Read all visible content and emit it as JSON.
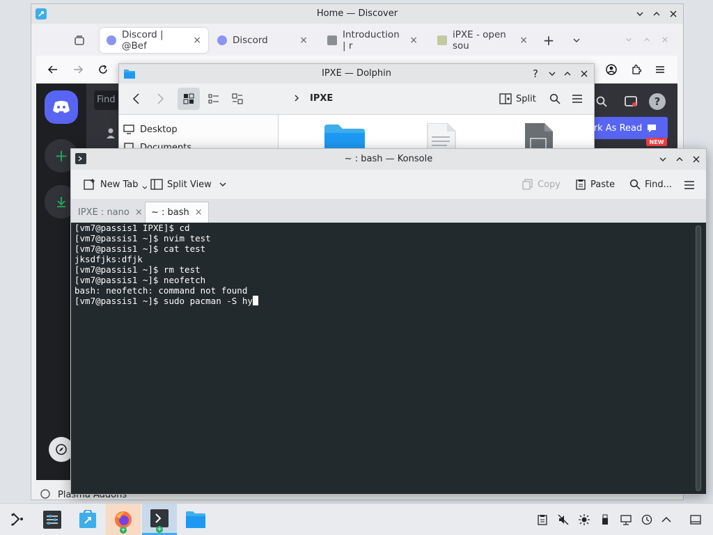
{
  "discover": {
    "title": "Home — Discover",
    "plasma_item": "Plasma Addons"
  },
  "firefox": {
    "tabs": [
      {
        "label": "Discord | @Bef",
        "close": "×"
      },
      {
        "label": "Discord",
        "close": "×"
      },
      {
        "label": "Introduction | r",
        "close": "×"
      },
      {
        "label": "iPXE - open sou",
        "close": "×"
      }
    ],
    "new_tab": "+"
  },
  "discord": {
    "search_placeholder": "Find o",
    "mark_as_read": "rk As Read",
    "new_badge": "NEW",
    "add_server": "+"
  },
  "dolphin": {
    "title": "IPXE — Dolphin",
    "breadcrumb": "IPXE",
    "split_label": "Split",
    "places": [
      "Desktop",
      "Documents"
    ]
  },
  "konsole": {
    "title": "~ : bash — Konsole",
    "toolbar": {
      "new_tab": "New Tab",
      "split_view": "Split View",
      "copy": "Copy",
      "paste": "Paste",
      "find": "Find..."
    },
    "tabs": [
      {
        "label": "IPXE : nano",
        "close": "×"
      },
      {
        "label": "~ : bash",
        "close": "×"
      }
    ],
    "terminal_lines": [
      "[vm7@passis1 IPXE]$ cd",
      "[vm7@passis1 ~]$ nvim test",
      "[vm7@passis1 ~]$ cat test",
      "jksdfjks:dfjk",
      "[vm7@passis1 ~]$ rm test",
      "[vm7@passis1 ~]$ neofetch",
      "bash: neofetch: command not found",
      "[vm7@passis1 ~]$ sudo pacman -S hy"
    ]
  },
  "colors": {
    "accent": "#3daee9",
    "discord_blurple": "#5865f2",
    "discord_green": "#23a559",
    "terminal_bg": "#232a2d",
    "terminal_fg": "#fcfcfc",
    "folder_blue": "#1d99f3",
    "firefox_orange": "#ff7139"
  }
}
